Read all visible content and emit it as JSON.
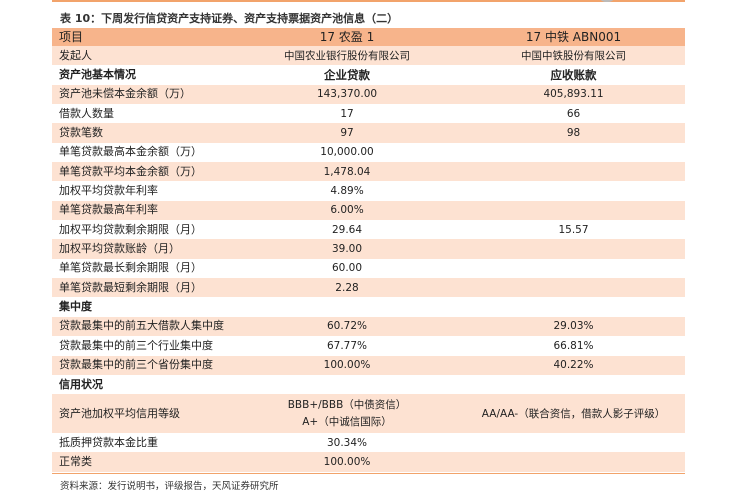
{
  "title": "表 10：下周发行信贷资产支持证券、资产支持票据资产池信息（二）",
  "columns": [
    "项目",
    "17 农盈 1",
    "17 中铁 ABN001"
  ],
  "rows": [
    {
      "label": "发起人",
      "v1": "中国农业银行股份有限公司",
      "v2": "中国中铁股份有限公司"
    },
    {
      "label": "资产池基本情况",
      "v1": "企业贷款",
      "v2": "应收账款"
    },
    {
      "label": "资产池未偿本金余额（万）",
      "v1": "143,370.00",
      "v2": "405,893.11"
    },
    {
      "label": "借款人数量",
      "v1": "17",
      "v2": "66"
    },
    {
      "label": "贷款笔数",
      "v1": "97",
      "v2": "98"
    },
    {
      "label": "单笔贷款最高本金余额（万）",
      "v1": "10,000.00",
      "v2": ""
    },
    {
      "label": "单笔贷款平均本金余额（万）",
      "v1": "1,478.04",
      "v2": ""
    },
    {
      "label": "加权平均贷款年利率",
      "v1": "4.89%",
      "v2": ""
    },
    {
      "label": "单笔贷款最高年利率",
      "v1": "6.00%",
      "v2": ""
    },
    {
      "label": "加权平均贷款剩余期限（月）",
      "v1": "29.64",
      "v2": "15.57"
    },
    {
      "label": "加权平均贷款账龄（月）",
      "v1": "39.00",
      "v2": ""
    },
    {
      "label": "单笔贷款最长剩余期限（月）",
      "v1": "60.00",
      "v2": ""
    },
    {
      "label": "单笔贷款最短剩余期限（月）",
      "v1": "2.28",
      "v2": ""
    },
    {
      "label": "集中度",
      "v1": "",
      "v2": ""
    },
    {
      "label": "贷款最集中的前五大借款人集中度",
      "v1": "60.72%",
      "v2": "29.03%"
    },
    {
      "label": "贷款最集中的前三个行业集中度",
      "v1": "67.77%",
      "v2": "66.81%"
    },
    {
      "label": "贷款最集中的前三个省份集中度",
      "v1": "100.00%",
      "v2": "40.22%"
    },
    {
      "label": "信用状况",
      "v1": "",
      "v2": ""
    },
    {
      "label": "资产池加权平均信用等级",
      "v1": "BBB+/BBB（中债资信）",
      "v1b": "A+（中诚信国际）",
      "v2": "AA/AA-（联合资信，借款人影子评级）"
    },
    {
      "label": "抵质押贷款本金比重",
      "v1": "30.34%",
      "v2": ""
    },
    {
      "label": "正常类",
      "v1": "100.00%",
      "v2": ""
    }
  ],
  "source": "资料来源：发行说明书，评级报告，天风证券研究所",
  "colors": {
    "header": "#f7b48b",
    "shade": "#fde2d2",
    "rule": "#f2a36b"
  }
}
